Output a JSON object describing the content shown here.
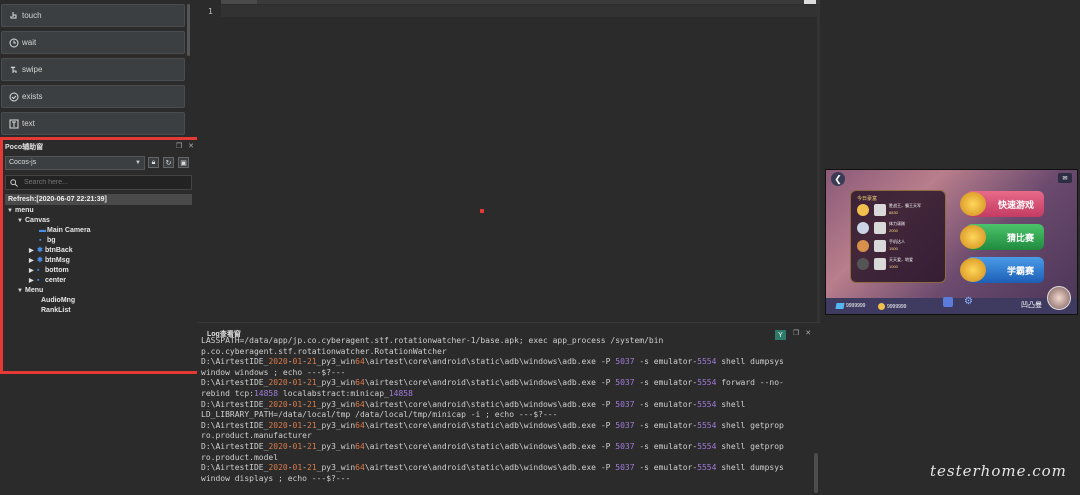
{
  "api_buttons": [
    {
      "label": "touch",
      "icon": "touch-icon"
    },
    {
      "label": "wait",
      "icon": "clock-icon"
    },
    {
      "label": "swipe",
      "icon": "swipe-icon"
    },
    {
      "label": "exists",
      "icon": "exists-icon"
    },
    {
      "label": "text",
      "icon": "text-icon"
    }
  ],
  "poco": {
    "title": "Poco辅助窗",
    "mode": "Cocos-js",
    "search_placeholder": "Search here...",
    "refresh": "Refresh:[2020-06-07 22:21:39]",
    "tree": [
      {
        "label": "menu",
        "expander": "▼"
      },
      {
        "label": "Canvas",
        "expander": "▼"
      },
      {
        "label": "Main Camera",
        "expander": ""
      },
      {
        "label": "bg",
        "expander": ""
      },
      {
        "label": "btnBack",
        "expander": "▶"
      },
      {
        "label": "btnMsg",
        "expander": "▶"
      },
      {
        "label": "bottom",
        "expander": "▶"
      },
      {
        "label": "center",
        "expander": "▶"
      },
      {
        "label": "Menu",
        "expander": "▼"
      },
      {
        "label": "AudioMng",
        "expander": ""
      },
      {
        "label": "RankList",
        "expander": ""
      }
    ]
  },
  "editor": {
    "line_number": "1"
  },
  "log": {
    "title": "Log查看窗",
    "filter_icon": "Y",
    "lines": [
      [
        {
          "t": "LASSPATH=/data/app/jp.co.cyberagent.stf.rotationwatcher-1/base.apk; exec app_process /system/bin"
        }
      ],
      [
        {
          "t": "p.co.cyberagent.stf.rotationwatcher.RotationWatcher"
        }
      ],
      [
        {
          "t": "D:\\AirtestIDE_"
        },
        {
          "t": "2020",
          "c": "o"
        },
        {
          "t": "-"
        },
        {
          "t": "01",
          "c": "o"
        },
        {
          "t": "-"
        },
        {
          "t": "21",
          "c": "o"
        },
        {
          "t": "_py3_win"
        },
        {
          "t": "64",
          "c": "o"
        },
        {
          "t": "\\airtest\\core\\android\\static\\adb\\windows\\adb.exe -P "
        },
        {
          "t": "5037",
          "c": "p"
        },
        {
          "t": " -s emulator-"
        },
        {
          "t": "5554",
          "c": "p"
        },
        {
          "t": " shell dumpsys"
        }
      ],
      [
        {
          "t": "window windows ; echo ---$?---"
        }
      ],
      [
        {
          "t": "D:\\AirtestIDE_"
        },
        {
          "t": "2020",
          "c": "o"
        },
        {
          "t": "-"
        },
        {
          "t": "01",
          "c": "o"
        },
        {
          "t": "-"
        },
        {
          "t": "21",
          "c": "o"
        },
        {
          "t": "_py3_win"
        },
        {
          "t": "64",
          "c": "o"
        },
        {
          "t": "\\airtest\\core\\android\\static\\adb\\windows\\adb.exe -P "
        },
        {
          "t": "5037",
          "c": "p"
        },
        {
          "t": " -s emulator-"
        },
        {
          "t": "5554",
          "c": "p"
        },
        {
          "t": " forward --no-"
        }
      ],
      [
        {
          "t": "rebind tcp:"
        },
        {
          "t": "14858",
          "c": "p"
        },
        {
          "t": " localabstract:minicap_"
        },
        {
          "t": "14858",
          "c": "p"
        }
      ],
      [
        {
          "t": "D:\\AirtestIDE_"
        },
        {
          "t": "2020",
          "c": "o"
        },
        {
          "t": "-"
        },
        {
          "t": "01",
          "c": "o"
        },
        {
          "t": "-"
        },
        {
          "t": "21",
          "c": "o"
        },
        {
          "t": "_py3_win"
        },
        {
          "t": "64",
          "c": "o"
        },
        {
          "t": "\\airtest\\core\\android\\static\\adb\\windows\\adb.exe -P "
        },
        {
          "t": "5037",
          "c": "p"
        },
        {
          "t": " -s emulator-"
        },
        {
          "t": "5554",
          "c": "p"
        },
        {
          "t": " shell"
        }
      ],
      [
        {
          "t": "LD_LIBRARY_PATH=/data/local/tmp /data/local/tmp/minicap -i ; echo ---$?---"
        }
      ],
      [
        {
          "t": "D:\\AirtestIDE_"
        },
        {
          "t": "2020",
          "c": "o"
        },
        {
          "t": "-"
        },
        {
          "t": "01",
          "c": "o"
        },
        {
          "t": "-"
        },
        {
          "t": "21",
          "c": "o"
        },
        {
          "t": "_py3_win"
        },
        {
          "t": "64",
          "c": "o"
        },
        {
          "t": "\\airtest\\core\\android\\static\\adb\\windows\\adb.exe -P "
        },
        {
          "t": "5037",
          "c": "p"
        },
        {
          "t": " -s emulator-"
        },
        {
          "t": "5554",
          "c": "p"
        },
        {
          "t": " shell getprop"
        }
      ],
      [
        {
          "t": "ro.product.manufacturer"
        }
      ],
      [
        {
          "t": "D:\\AirtestIDE_"
        },
        {
          "t": "2020",
          "c": "o"
        },
        {
          "t": "-"
        },
        {
          "t": "01",
          "c": "o"
        },
        {
          "t": "-"
        },
        {
          "t": "21",
          "c": "o"
        },
        {
          "t": "_py3_win"
        },
        {
          "t": "64",
          "c": "o"
        },
        {
          "t": "\\airtest\\core\\android\\static\\adb\\windows\\adb.exe -P "
        },
        {
          "t": "5037",
          "c": "p"
        },
        {
          "t": " -s emulator-"
        },
        {
          "t": "5554",
          "c": "p"
        },
        {
          "t": " shell getprop"
        }
      ],
      [
        {
          "t": "ro.product.model"
        }
      ],
      [
        {
          "t": "D:\\AirtestIDE_"
        },
        {
          "t": "2020",
          "c": "o"
        },
        {
          "t": "-"
        },
        {
          "t": "01",
          "c": "o"
        },
        {
          "t": "-"
        },
        {
          "t": "21",
          "c": "o"
        },
        {
          "t": "_py3_win"
        },
        {
          "t": "64",
          "c": "o"
        },
        {
          "t": "\\airtest\\core\\android\\static\\adb\\windows\\adb.exe -P "
        },
        {
          "t": "5037",
          "c": "p"
        },
        {
          "t": " -s emulator-"
        },
        {
          "t": "5554",
          "c": "p"
        },
        {
          "t": " shell dumpsys"
        }
      ],
      [
        {
          "t": "window displays ; echo ---$?---"
        }
      ]
    ]
  },
  "device": {
    "rank_title": "今日豪富",
    "rank": [
      {
        "name": "胜战王，霸王天军",
        "score": "8830"
      },
      {
        "name": "体力顽刚",
        "score": "2000"
      },
      {
        "name": "手机达人",
        "score": "1500"
      },
      {
        "name": "天天爱，地爱",
        "score": "1000"
      }
    ],
    "game_buttons": [
      "快速游戏",
      "猜比赛",
      "学霸赛"
    ],
    "diamonds": "9999999",
    "coins": "9999999",
    "nickname": "凹凸曼"
  },
  "watermark": "testerhome.com",
  "colors": {
    "highlight_border": "#e53935",
    "log_orange": "#d97b4a",
    "log_purple": "#a07ad8",
    "tree_node_blue": "#4a8ee8"
  }
}
